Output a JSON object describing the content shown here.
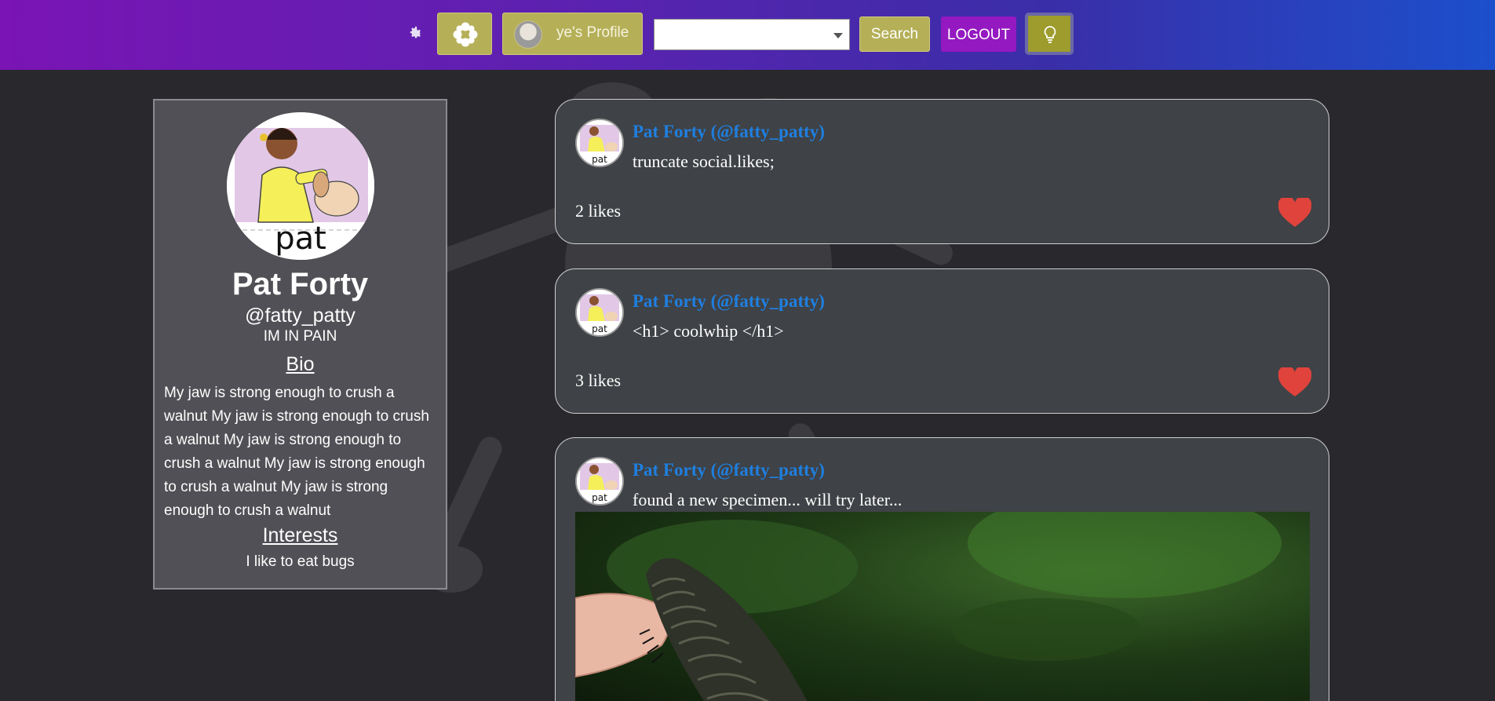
{
  "topbar": {
    "profile_label": "ye's Profile",
    "search_label": "Search",
    "logout_label": "LOGOUT",
    "select_value": "",
    "icons": [
      "gear-icon",
      "flower-icon",
      "lightbulb-icon"
    ]
  },
  "profile": {
    "name": "Pat Forty",
    "handle": "@fatty_patty",
    "status": "IM IN PAIN",
    "bio_heading": "Bio",
    "bio": "My jaw is strong enough to crush a walnut My jaw is strong enough to crush a walnut My jaw is strong enough to crush a walnut My jaw is strong enough to crush a walnut My jaw is strong enough to crush a walnut",
    "interests_heading": "Interests",
    "interests": "I like to eat bugs",
    "avatar_caption": "pat"
  },
  "posts": [
    {
      "author": "Pat Forty (@fatty_patty)",
      "text": "truncate social.likes;",
      "likes": "2 likes"
    },
    {
      "author": "Pat Forty (@fatty_patty)",
      "text": "<h1> coolwhip </h1>",
      "likes": "3 likes"
    },
    {
      "author": "Pat Forty (@fatty_patty)",
      "text": "found a new specimen... will try later..."
    }
  ],
  "colors": {
    "topbar_start": "#7a14b4",
    "topbar_end": "#1c4fcc",
    "olive_button": "#b5b058",
    "logout_button": "#9419c0",
    "author_link": "#1f7fe0",
    "heart": "#e0433c",
    "background": "#28282d"
  }
}
